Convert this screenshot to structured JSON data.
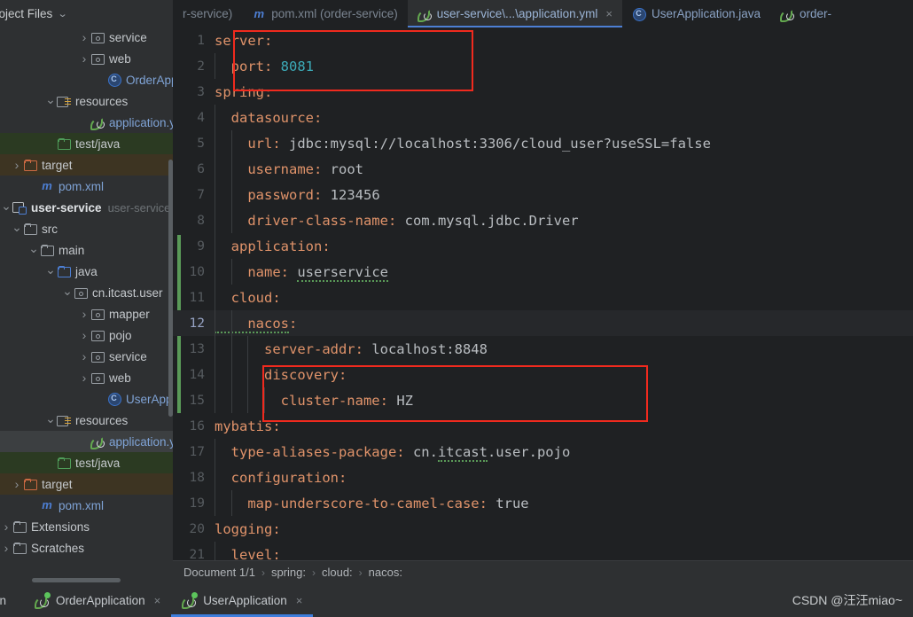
{
  "sidebar": {
    "header": {
      "title": "roject Files",
      "chevron_icon": "chevron-down-icon"
    },
    "items": [
      {
        "label": "service",
        "icon": "package-icon",
        "twist": "r",
        "indent": 88,
        "style": "white",
        "row": ""
      },
      {
        "label": "web",
        "icon": "package-icon",
        "twist": "r",
        "indent": 88,
        "style": "white",
        "row": ""
      },
      {
        "label": "OrderApplic",
        "icon": "spring-class-icon",
        "twist": "none",
        "indent": 107,
        "style": "blue",
        "row": ""
      },
      {
        "label": "resources",
        "icon": "resources-icon",
        "twist": "d",
        "indent": 50,
        "style": "white",
        "row": ""
      },
      {
        "label": "application.yml",
        "icon": "spring-leaf-icon",
        "twist": "none",
        "indent": 88,
        "style": "blue",
        "row": ""
      },
      {
        "label": "test/java",
        "icon": "folder-green-icon",
        "twist": "none",
        "indent": 50,
        "style": "white",
        "row": "green"
      },
      {
        "label": "target",
        "icon": "folder-orange-icon",
        "twist": "r",
        "indent": 12,
        "style": "white",
        "row": "brown"
      },
      {
        "label": "pom.xml",
        "icon": "maven-icon",
        "twist": "none",
        "indent": 31,
        "style": "blue",
        "row": ""
      },
      {
        "label": "user-service",
        "icon": "module-icon",
        "twist": "d",
        "indent": -4,
        "style": "bold",
        "row": "",
        "suffix": "user-service"
      },
      {
        "label": "src",
        "icon": "folder-icon",
        "twist": "d",
        "indent": 12,
        "style": "white",
        "row": ""
      },
      {
        "label": "main",
        "icon": "folder-icon",
        "twist": "d",
        "indent": 31,
        "style": "white",
        "row": ""
      },
      {
        "label": "java",
        "icon": "folder-blue-icon",
        "twist": "d",
        "indent": 50,
        "style": "white",
        "row": ""
      },
      {
        "label": "cn.itcast.user",
        "icon": "package-icon",
        "twist": "d",
        "indent": 69,
        "style": "white",
        "row": ""
      },
      {
        "label": "mapper",
        "icon": "package-icon",
        "twist": "r",
        "indent": 88,
        "style": "white",
        "row": ""
      },
      {
        "label": "pojo",
        "icon": "package-icon",
        "twist": "r",
        "indent": 88,
        "style": "white",
        "row": ""
      },
      {
        "label": "service",
        "icon": "package-icon",
        "twist": "r",
        "indent": 88,
        "style": "white",
        "row": ""
      },
      {
        "label": "web",
        "icon": "package-icon",
        "twist": "r",
        "indent": 88,
        "style": "white",
        "row": ""
      },
      {
        "label": "UserApplica",
        "icon": "spring-class-icon",
        "twist": "none",
        "indent": 107,
        "style": "blue",
        "row": ""
      },
      {
        "label": "resources",
        "icon": "resources-icon",
        "twist": "d",
        "indent": 50,
        "style": "white",
        "row": ""
      },
      {
        "label": "application.yml",
        "icon": "spring-leaf-icon",
        "twist": "none",
        "indent": 88,
        "style": "blue",
        "row": "sel"
      },
      {
        "label": "test/java",
        "icon": "folder-green-icon",
        "twist": "none",
        "indent": 50,
        "style": "white",
        "row": "green"
      },
      {
        "label": "target",
        "icon": "folder-orange-icon",
        "twist": "r",
        "indent": 12,
        "style": "white",
        "row": "brown"
      },
      {
        "label": "pom.xml",
        "icon": "maven-icon",
        "twist": "none",
        "indent": 31,
        "style": "blue",
        "row": ""
      },
      {
        "label": "Extensions",
        "icon": "folder-icon",
        "twist": "r",
        "indent": -4,
        "style": "white",
        "row": ""
      },
      {
        "label": "Scratches",
        "icon": "folder-icon",
        "twist": "r",
        "indent": -4,
        "style": "white",
        "row": ""
      }
    ]
  },
  "tabs": [
    {
      "label": "r-service)",
      "icon": "none",
      "active": false,
      "closable": false,
      "dim": true
    },
    {
      "label": "pom.xml (order-service)",
      "icon": "maven-icon",
      "active": false,
      "closable": false,
      "dim": true
    },
    {
      "label": "user-service\\...\\application.yml",
      "icon": "spring-leaf-icon",
      "active": true,
      "closable": true,
      "dim": false
    },
    {
      "label": "UserApplication.java",
      "icon": "spring-class-icon",
      "active": false,
      "closable": false,
      "dim": false
    },
    {
      "label": "order-",
      "icon": "spring-leaf-icon",
      "active": false,
      "closable": false,
      "dim": false
    }
  ],
  "editor": {
    "filename": "application.yml",
    "current_line": 12,
    "lines": [
      {
        "no": 1,
        "segments": [
          {
            "t": "server:",
            "c": "k"
          }
        ]
      },
      {
        "no": 2,
        "segments": [
          {
            "t": "  port: ",
            "c": "k"
          },
          {
            "t": "8081",
            "c": "n"
          }
        ]
      },
      {
        "no": 3,
        "segments": [
          {
            "t": "spring:",
            "c": "k"
          }
        ]
      },
      {
        "no": 4,
        "segments": [
          {
            "t": "  datasource:",
            "c": "k"
          }
        ]
      },
      {
        "no": 5,
        "segments": [
          {
            "t": "    url: ",
            "c": "k"
          },
          {
            "t": "jdbc:mysql://localhost:3306/cloud_user?useSSL=false",
            "c": "v"
          }
        ]
      },
      {
        "no": 6,
        "segments": [
          {
            "t": "    username: ",
            "c": "k"
          },
          {
            "t": "root",
            "c": "v"
          }
        ]
      },
      {
        "no": 7,
        "segments": [
          {
            "t": "    password: ",
            "c": "k"
          },
          {
            "t": "123456",
            "c": "v"
          }
        ]
      },
      {
        "no": 8,
        "segments": [
          {
            "t": "    driver-class-name: ",
            "c": "k"
          },
          {
            "t": "com.mysql.jdbc.Driver",
            "c": "v"
          }
        ]
      },
      {
        "no": 9,
        "segments": [
          {
            "t": "  application:",
            "c": "k"
          }
        ]
      },
      {
        "no": 10,
        "segments": [
          {
            "t": "    name: ",
            "c": "k"
          },
          {
            "t": "userservice",
            "c": "v sq"
          }
        ]
      },
      {
        "no": 11,
        "segments": [
          {
            "t": "  cloud:",
            "c": "k"
          }
        ]
      },
      {
        "no": 12,
        "segments": [
          {
            "t": "    nacos",
            "c": "k sq"
          },
          {
            "t": ":",
            "c": "k"
          }
        ]
      },
      {
        "no": 13,
        "segments": [
          {
            "t": "      server-addr: ",
            "c": "k"
          },
          {
            "t": "localhost:8848",
            "c": "v"
          }
        ]
      },
      {
        "no": 14,
        "segments": [
          {
            "t": "      discovery:",
            "c": "k"
          }
        ]
      },
      {
        "no": 15,
        "segments": [
          {
            "t": "        cluster-name: ",
            "c": "k"
          },
          {
            "t": "HZ",
            "c": "v"
          }
        ]
      },
      {
        "no": 16,
        "segments": [
          {
            "t": "mybatis:",
            "c": "k"
          }
        ]
      },
      {
        "no": 17,
        "segments": [
          {
            "t": "  type-aliases-package: ",
            "c": "k"
          },
          {
            "t": "cn.",
            "c": "v"
          },
          {
            "t": "itcast",
            "c": "v sq"
          },
          {
            "t": ".user.pojo",
            "c": "v"
          }
        ]
      },
      {
        "no": 18,
        "segments": [
          {
            "t": "  configuration:",
            "c": "k"
          }
        ]
      },
      {
        "no": 19,
        "segments": [
          {
            "t": "    map-underscore-to-camel-case: ",
            "c": "k"
          },
          {
            "t": "true",
            "c": "v"
          }
        ]
      },
      {
        "no": 20,
        "segments": [
          {
            "t": "logging:",
            "c": "k"
          }
        ]
      },
      {
        "no": 21,
        "segments": [
          {
            "t": "  level:",
            "c": "k"
          }
        ]
      }
    ],
    "annotations": [
      {
        "name": "server-port-highlight",
        "lines": "1-2"
      },
      {
        "name": "discovery-cluster-highlight",
        "lines": "14-15"
      }
    ],
    "annotation_color": "#f02a1e"
  },
  "breadcrumb": {
    "document": "Document 1/1",
    "separator": "›",
    "path": [
      "spring:",
      "cloud:",
      "nacos:"
    ]
  },
  "run_panel": {
    "label": "un",
    "tabs": [
      {
        "label": "OrderApplication",
        "active": false,
        "running": true,
        "closable": true
      },
      {
        "label": "UserApplication",
        "active": true,
        "running": true,
        "closable": true
      }
    ],
    "close_icon": "close-icon"
  },
  "watermark": {
    "text": "CSDN @汪汪miao~"
  },
  "colors": {
    "editor_bg": "#1f2123",
    "panel_bg": "#2e3032",
    "accent_blue": "#4d7fd4",
    "yaml_key": "#e0936a",
    "yaml_number": "#3cabb8",
    "annotation_red": "#f02a1e",
    "change_marker_green": "#5a9a58"
  }
}
